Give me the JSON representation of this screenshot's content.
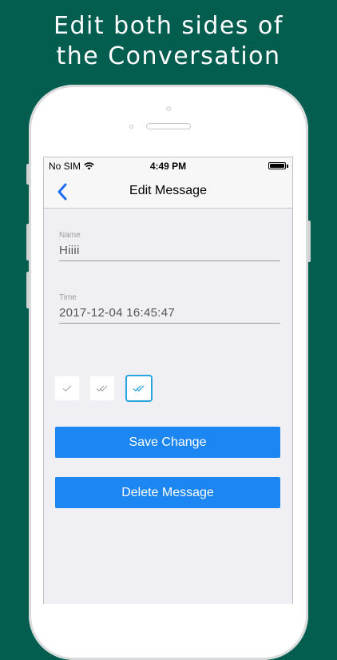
{
  "headline": {
    "line1": "Edit both sides of",
    "line2": "the Conversation"
  },
  "status_bar": {
    "carrier": "No SIM",
    "time": "4:49 PM"
  },
  "nav": {
    "title": "Edit Message"
  },
  "form": {
    "name_label": "Name",
    "name_value": "Hiiii",
    "time_label": "Time",
    "time_value": "2017-12-04 16:45:47"
  },
  "status_options": [
    {
      "icon": "single-check-icon",
      "selected": false
    },
    {
      "icon": "double-check-gray-icon",
      "selected": false
    },
    {
      "icon": "double-check-blue-icon",
      "selected": true
    }
  ],
  "buttons": {
    "save": "Save Change",
    "delete": "Delete Message"
  },
  "colors": {
    "background": "#035e50",
    "button": "#1c86f2",
    "nav_back": "#1c6ef2",
    "selected_border": "#2aa4dd"
  }
}
